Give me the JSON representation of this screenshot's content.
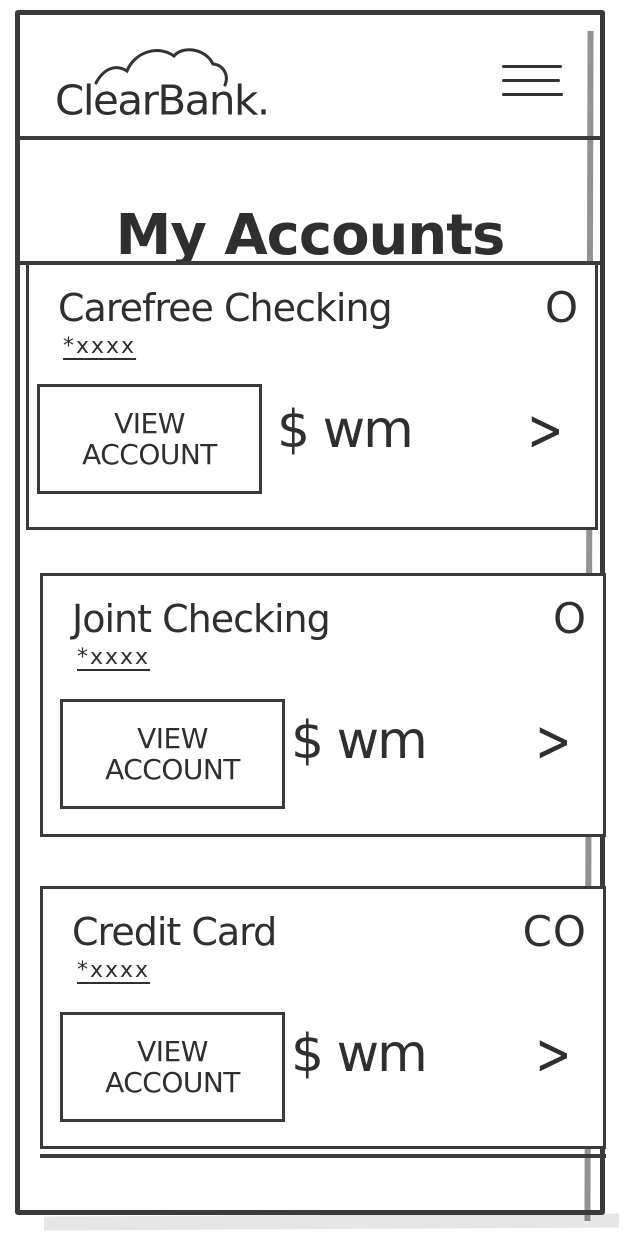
{
  "header": {
    "logo_text": "ClearBank.",
    "menu_icon": "hamburger-menu-icon"
  },
  "page": {
    "title": "My Accounts"
  },
  "accounts": [
    {
      "name": "Carefree Checking",
      "status": "O",
      "number": "*xxxx",
      "button_label": "VIEW\nACCOUNT",
      "balance": "$ wm",
      "chevron": ">"
    },
    {
      "name": "Joint Checking",
      "status": "O",
      "number": "*xxxx",
      "button_label": "VIEW\nACCOUNT",
      "balance": "$ wm",
      "chevron": ">"
    },
    {
      "name": "Credit Card",
      "status": "CO",
      "number": "*xxxx",
      "button_label": "VIEW\nACCOUNT",
      "balance": "$ wm",
      "chevron": ">"
    }
  ]
}
